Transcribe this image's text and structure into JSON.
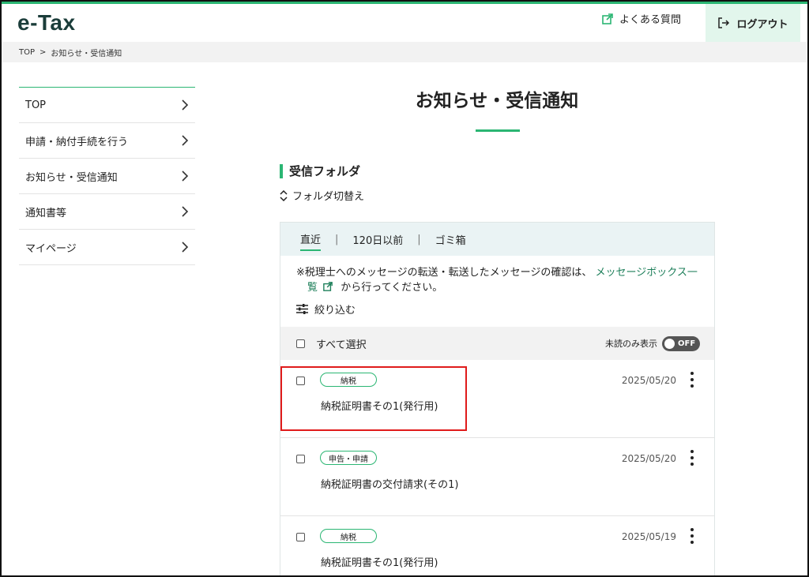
{
  "header": {
    "logo": "e-Tax",
    "faq_label": "よくある質問",
    "logout_label": "ログアウト"
  },
  "breadcrumb": {
    "home": "TOP",
    "separator": ">",
    "current": "お知らせ・受信通知"
  },
  "sidebar": {
    "items": [
      {
        "label": "TOP"
      },
      {
        "label": "申請・納付手続を行う"
      },
      {
        "label": "お知らせ・受信通知"
      },
      {
        "label": "通知書等"
      },
      {
        "label": "マイページ"
      }
    ]
  },
  "main": {
    "title": "お知らせ・受信通知",
    "section_title": "受信フォルダ",
    "folder_switch": "フォルダ切替え",
    "tabs": [
      {
        "label": "直近",
        "active": true
      },
      {
        "label": "120日以前",
        "active": false
      },
      {
        "label": "ゴミ箱",
        "active": false
      }
    ],
    "tab_separator": "|",
    "notice_text": "※税理士へのメッセージの転送・転送したメッセージの確認は、",
    "notice_link": "メッセージボックス一覧",
    "notice_link_part1": "メッセージボックス一",
    "notice_link_part2": "覧",
    "notice_suffix": "から行ってください。",
    "filter_label": "絞り込む",
    "select_all": "すべて選択",
    "unread_only": "未読のみ表示",
    "toggle_state": "OFF",
    "messages": [
      {
        "tag": "納税",
        "date": "2025/05/20",
        "subject": "納税証明書その1(発行用)"
      },
      {
        "tag": "申告・申請",
        "date": "2025/05/20",
        "subject": "納税証明書の交付請求(その1)"
      },
      {
        "tag": "納税",
        "date": "2025/05/19",
        "subject": "納税証明書その1(発行用)"
      }
    ]
  },
  "colors": {
    "accent_green": "#2bb673",
    "link_green": "#1c7e59",
    "logo_color": "#1b3d3a",
    "logout_bg": "#e2f6ec",
    "tab_bar_bg": "#eaf3f4",
    "highlight_red": "#e01b1b"
  },
  "icons": {
    "faq": "external-link-icon",
    "logout": "logout-icon",
    "sidebar_chevron": "chevron-right-icon",
    "folder_switch": "up-down-chevron-icon",
    "filter": "sliders-icon",
    "row_menu": "kebab-menu-icon"
  }
}
